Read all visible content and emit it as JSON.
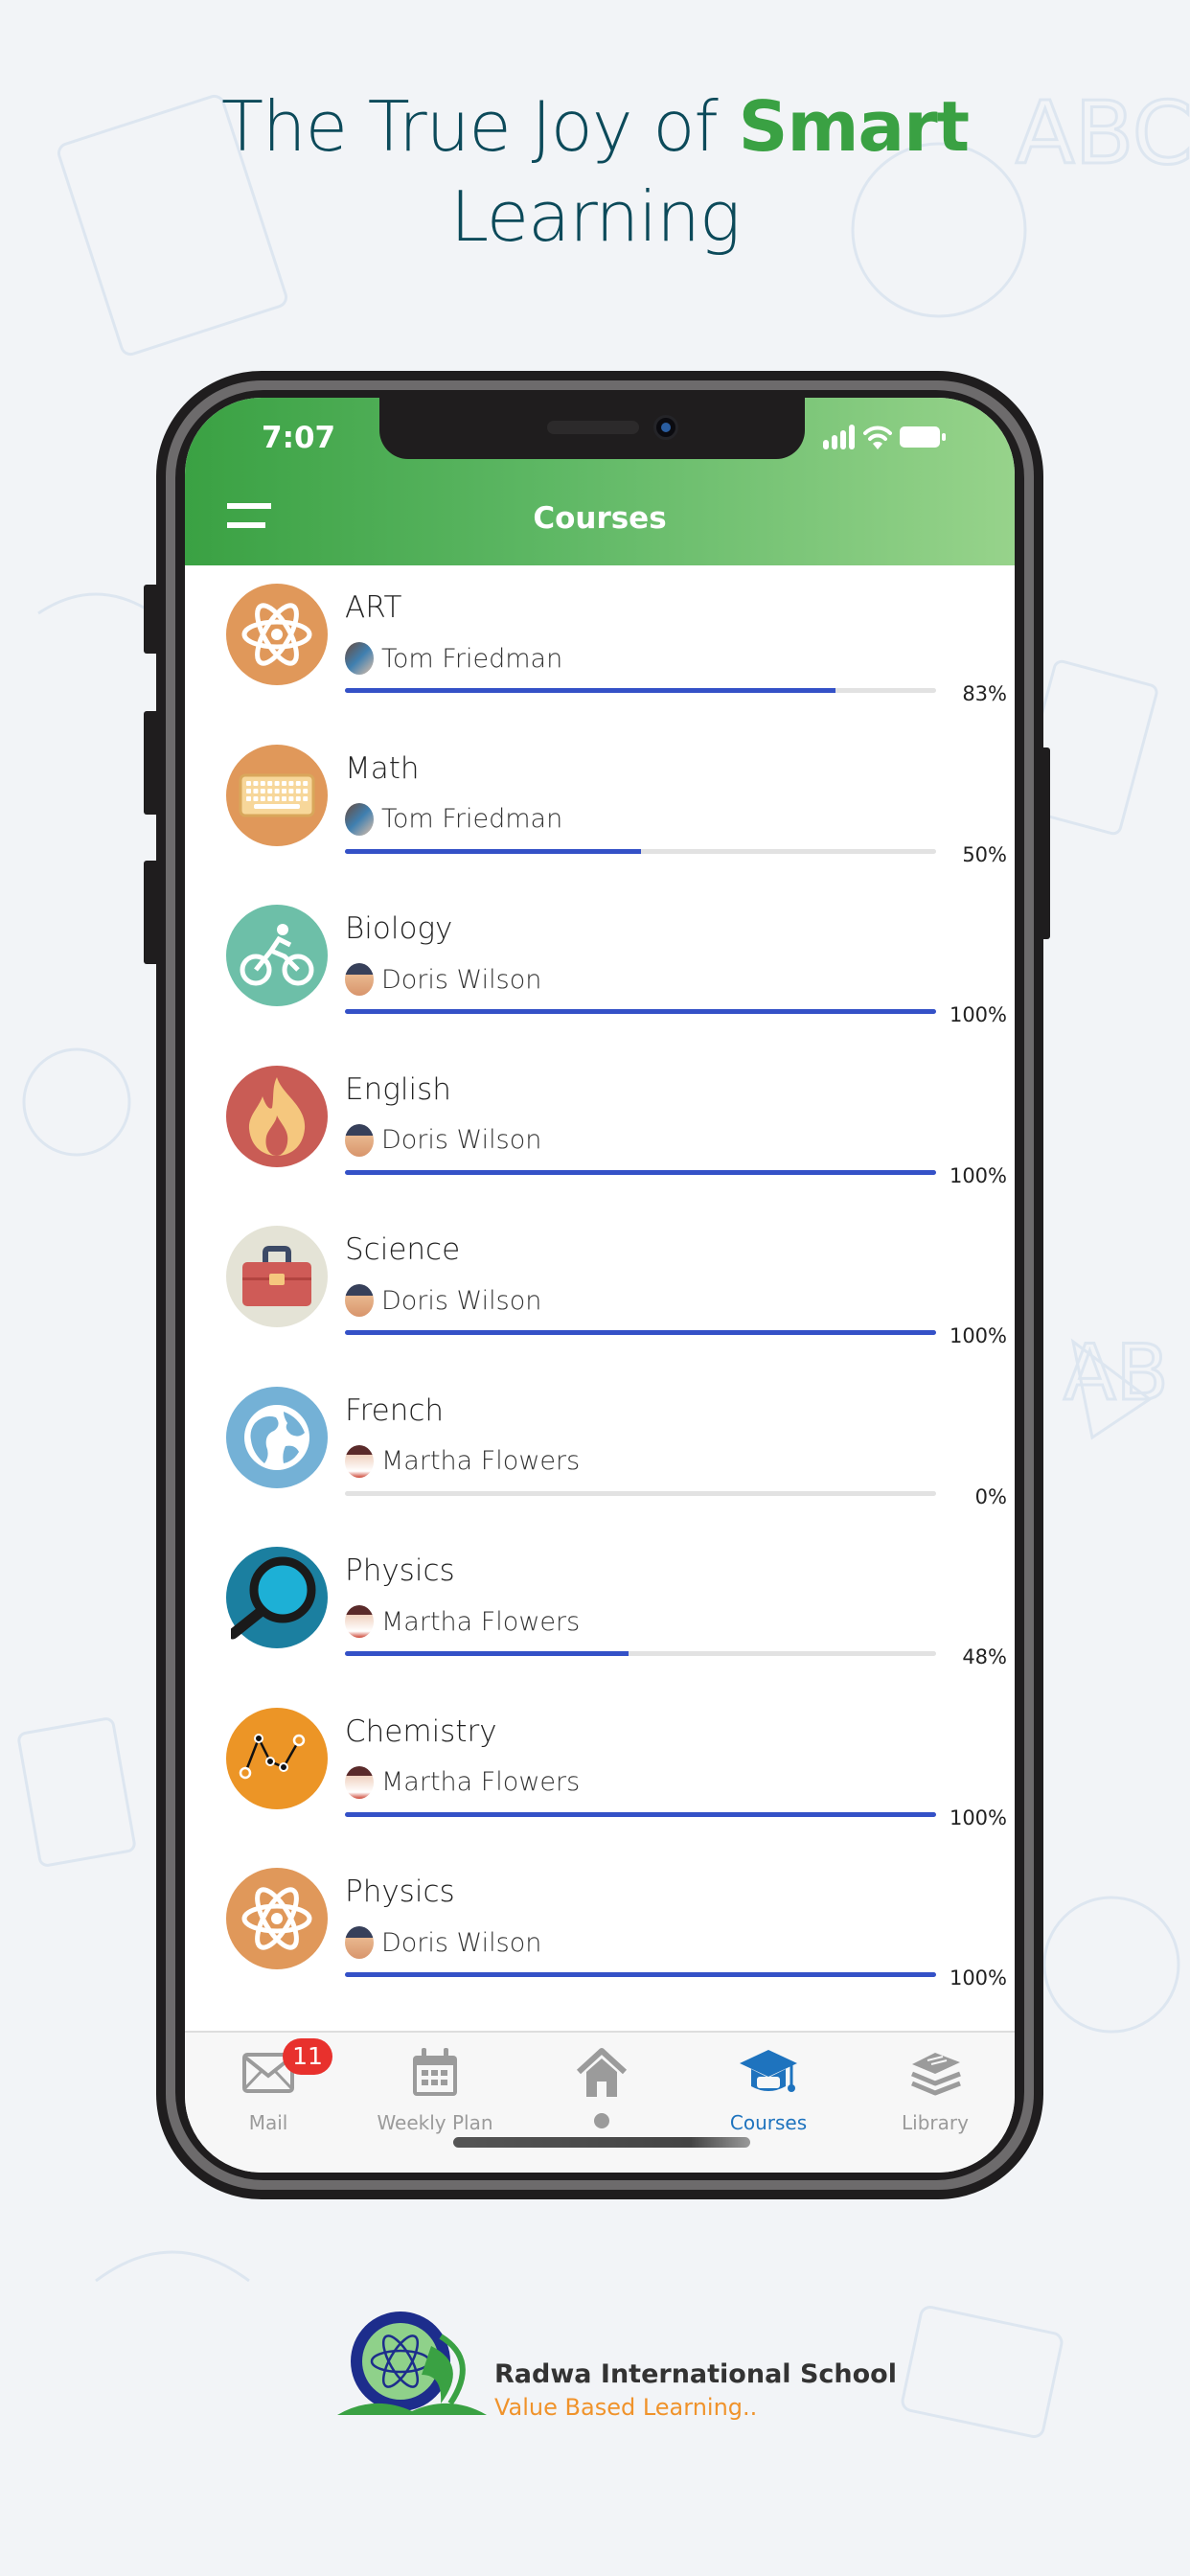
{
  "headline": {
    "text_before": "The True Joy of ",
    "accent": "Smart",
    "text_after": "Learning",
    "accent_color": "#3aa143",
    "text_color": "#0c4a5a"
  },
  "status_bar": {
    "time": "7:07",
    "icons": [
      "cellular-signal-icon",
      "wifi-icon",
      "battery-icon"
    ]
  },
  "header": {
    "title": "Courses",
    "menu_icon": "hamburger-menu-icon",
    "gradient": [
      "#3aa143",
      "#97d38b"
    ]
  },
  "courses": [
    {
      "name": "ART",
      "teacher": "Tom Friedman",
      "progress": 83,
      "progress_label": "83%",
      "icon": "atom-icon",
      "icon_bg": "#e0985a"
    },
    {
      "name": "Math",
      "teacher": "Tom Friedman",
      "progress": 50,
      "progress_label": "50%",
      "icon": "keyboard-icon",
      "icon_bg": "#e0985a"
    },
    {
      "name": "Biology",
      "teacher": "Doris Wilson",
      "progress": 100,
      "progress_label": "100%",
      "icon": "cyclist-icon",
      "icon_bg": "#6dbfa8"
    },
    {
      "name": "English",
      "teacher": "Doris Wilson",
      "progress": 100,
      "progress_label": "100%",
      "icon": "flame-icon",
      "icon_bg": "#c95c55"
    },
    {
      "name": "Science",
      "teacher": "Doris Wilson",
      "progress": 100,
      "progress_label": "100%",
      "icon": "toolbox-icon",
      "icon_bg": "#e4e3d6"
    },
    {
      "name": "French",
      "teacher": "Martha Flowers",
      "progress": 0,
      "progress_label": "0%",
      "icon": "globe-icon",
      "icon_bg": "#74b1d6"
    },
    {
      "name": "Physics",
      "teacher": "Martha Flowers",
      "progress": 48,
      "progress_label": "48%",
      "icon": "magnifier-icon",
      "icon_bg": "#1b7fa0"
    },
    {
      "name": "Chemistry",
      "teacher": "Martha Flowers",
      "progress": 100,
      "progress_label": "100%",
      "icon": "line-graph-icon",
      "icon_bg": "#ec9526"
    },
    {
      "name": "Physics",
      "teacher": "Doris Wilson",
      "progress": 100,
      "progress_label": "100%",
      "icon": "atom-icon",
      "icon_bg": "#e0985a"
    }
  ],
  "progress_colors": {
    "fill": "#3451c7",
    "track": "#e2e2e2"
  },
  "tabbar": {
    "tabs": [
      {
        "label": "Mail",
        "icon": "mail-icon",
        "badge": "11",
        "active": false
      },
      {
        "label": "Weekly Plan",
        "icon": "calendar-icon",
        "active": false
      },
      {
        "label": "",
        "icon": "home-icon",
        "active": false
      },
      {
        "label": "Courses",
        "icon": "graduation-cap-icon",
        "active": true
      },
      {
        "label": "Library",
        "icon": "books-icon",
        "active": false
      }
    ],
    "active_color": "#1e73be",
    "inactive_color": "#9b9b9b",
    "badge_color": "#e8312d"
  },
  "footer": {
    "school_name": "Radwa International School",
    "tagline": "Value Based Learning..",
    "tagline_color": "#f0932b"
  }
}
